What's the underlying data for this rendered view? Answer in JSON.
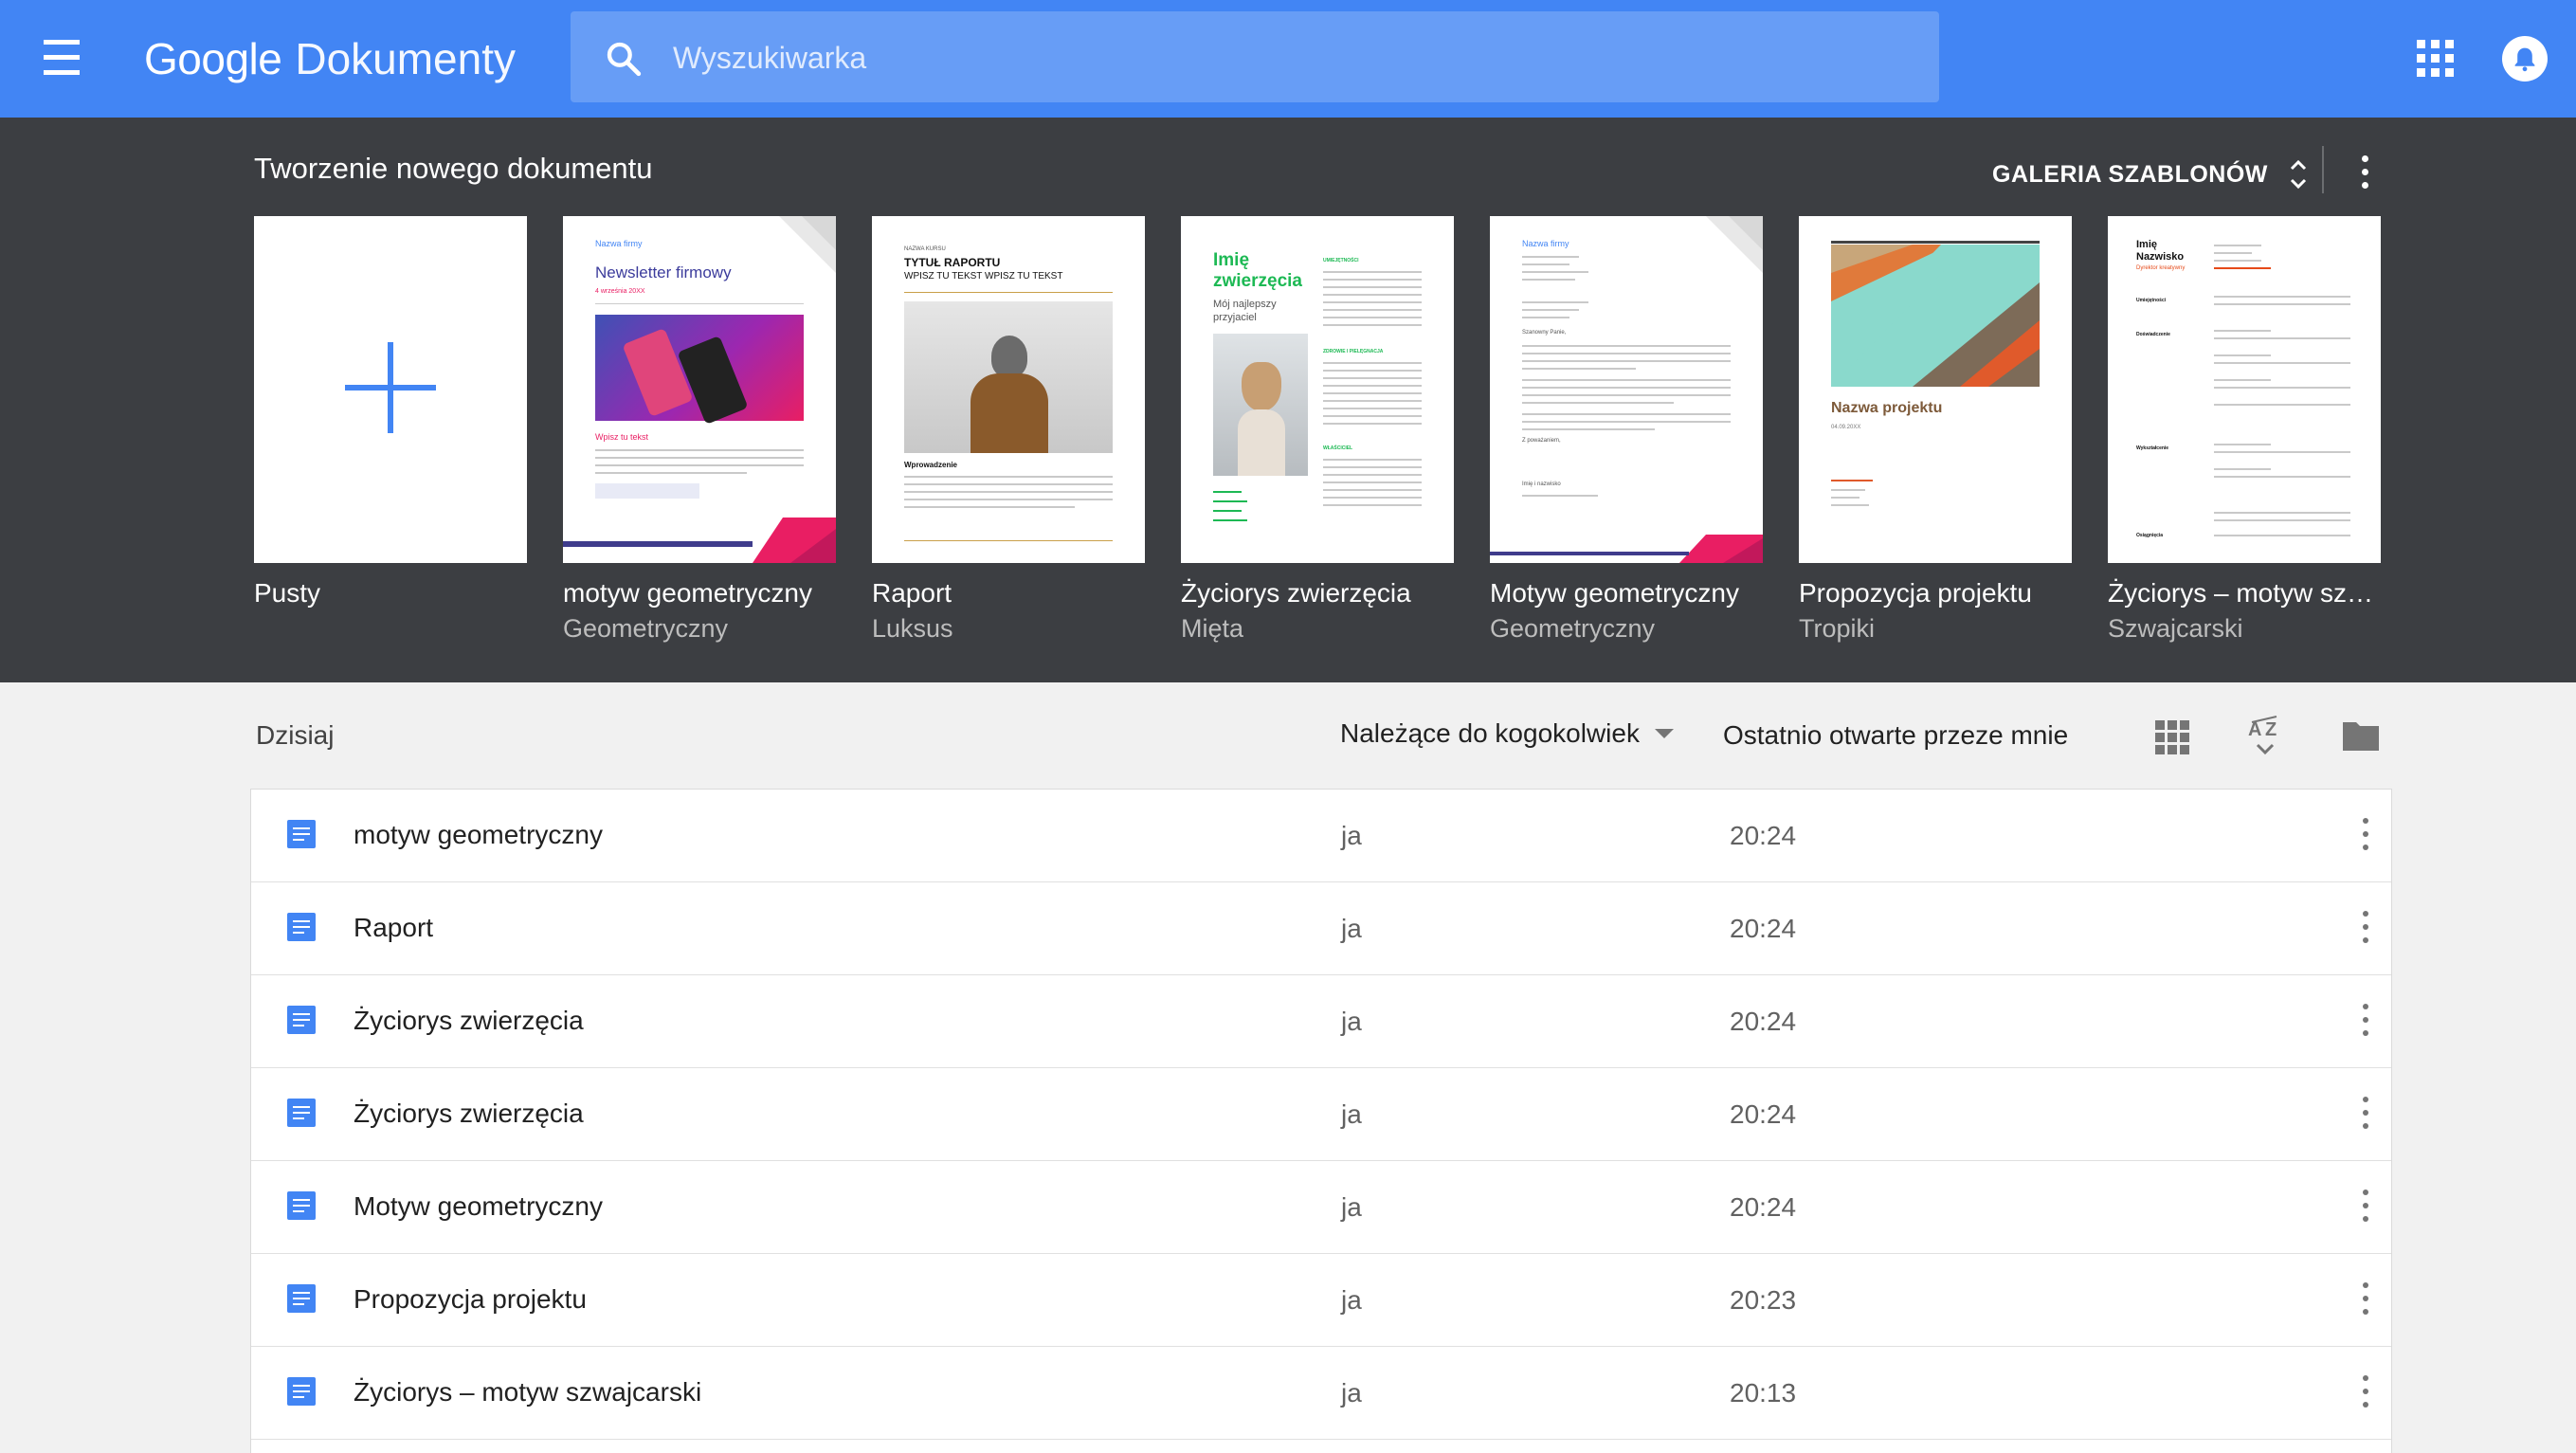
{
  "header": {
    "logo_google": "Google",
    "logo_product": "Dokumenty",
    "search_placeholder": "Wyszukiwarka",
    "accent_color": "#4285f4"
  },
  "templates": {
    "title": "Tworzenie nowego dokumentu",
    "gallery_label": "GALERIA SZABLONÓW",
    "cards": [
      {
        "name": "Pusty",
        "subtitle": ""
      },
      {
        "name": "motyw geometryczny",
        "subtitle": "Geometryczny"
      },
      {
        "name": "Raport",
        "subtitle": "Luksus"
      },
      {
        "name": "Życiorys zwierzęcia",
        "subtitle": "Mięta"
      },
      {
        "name": "Motyw geometryczny",
        "subtitle": "Geometryczny"
      },
      {
        "name": "Propozycja projektu",
        "subtitle": "Tropiki"
      },
      {
        "name": "Życiorys – motyw sz…",
        "subtitle": "Szwajcarski"
      }
    ],
    "thumb_text": {
      "newsletter_company": "Nazwa firmy",
      "newsletter_title": "Newsletter firmowy",
      "newsletter_date": "4 września 20XX",
      "newsletter_heading": "Wpisz tu tekst",
      "report_small": "NAZWA KURSU",
      "report_title": "TYTUŁ RAPORTU",
      "report_subtitle": "WPISZ TU TEKST WPISZ TU TEKST",
      "report_section": "Wprowadzenie",
      "pet_name_line1": "Imię",
      "pet_name_line2": "zwierzęcia",
      "pet_tagline_line1": "Mój najlepszy",
      "pet_tagline_line2": "przyjaciel",
      "pet_section1": "UMIEJĘTNOŚCI",
      "pet_section2": "ZDROWIE I PIELĘGNACJA",
      "pet_section3": "WŁAŚCICIEL",
      "letter_company": "Nazwa firmy",
      "letter_salutation": "Szanowny Panie,",
      "letter_closing": "Z poważaniem,",
      "letter_signature": "Imię i nazwisko",
      "proposal_title": "Nazwa projektu",
      "proposal_date": "04.09.20XX",
      "resume_name_line1": "Imię",
      "resume_name_line2": "Nazwisko",
      "resume_role": "Dyrektor kreatywny",
      "resume_s1": "Umiejętności",
      "resume_s2": "Doświadczenie",
      "resume_s3": "Wykształcenie",
      "resume_s4": "Osiągnięcia"
    }
  },
  "list": {
    "section_label": "Dzisiaj",
    "owner_filter": "Należące do kogokolwiek",
    "sort_label": "Ostatnio otwarte przeze mnie",
    "rows": [
      {
        "name": "motyw geometryczny",
        "owner": "ja",
        "time": "20:24"
      },
      {
        "name": "Raport",
        "owner": "ja",
        "time": "20:24"
      },
      {
        "name": "Życiorys zwierzęcia",
        "owner": "ja",
        "time": "20:24"
      },
      {
        "name": "Życiorys zwierzęcia",
        "owner": "ja",
        "time": "20:24"
      },
      {
        "name": "Motyw geometryczny",
        "owner": "ja",
        "time": "20:24"
      },
      {
        "name": "Propozycja projektu",
        "owner": "ja",
        "time": "20:23"
      },
      {
        "name": "Życiorys – motyw szwajcarski",
        "owner": "ja",
        "time": "20:13"
      }
    ]
  }
}
